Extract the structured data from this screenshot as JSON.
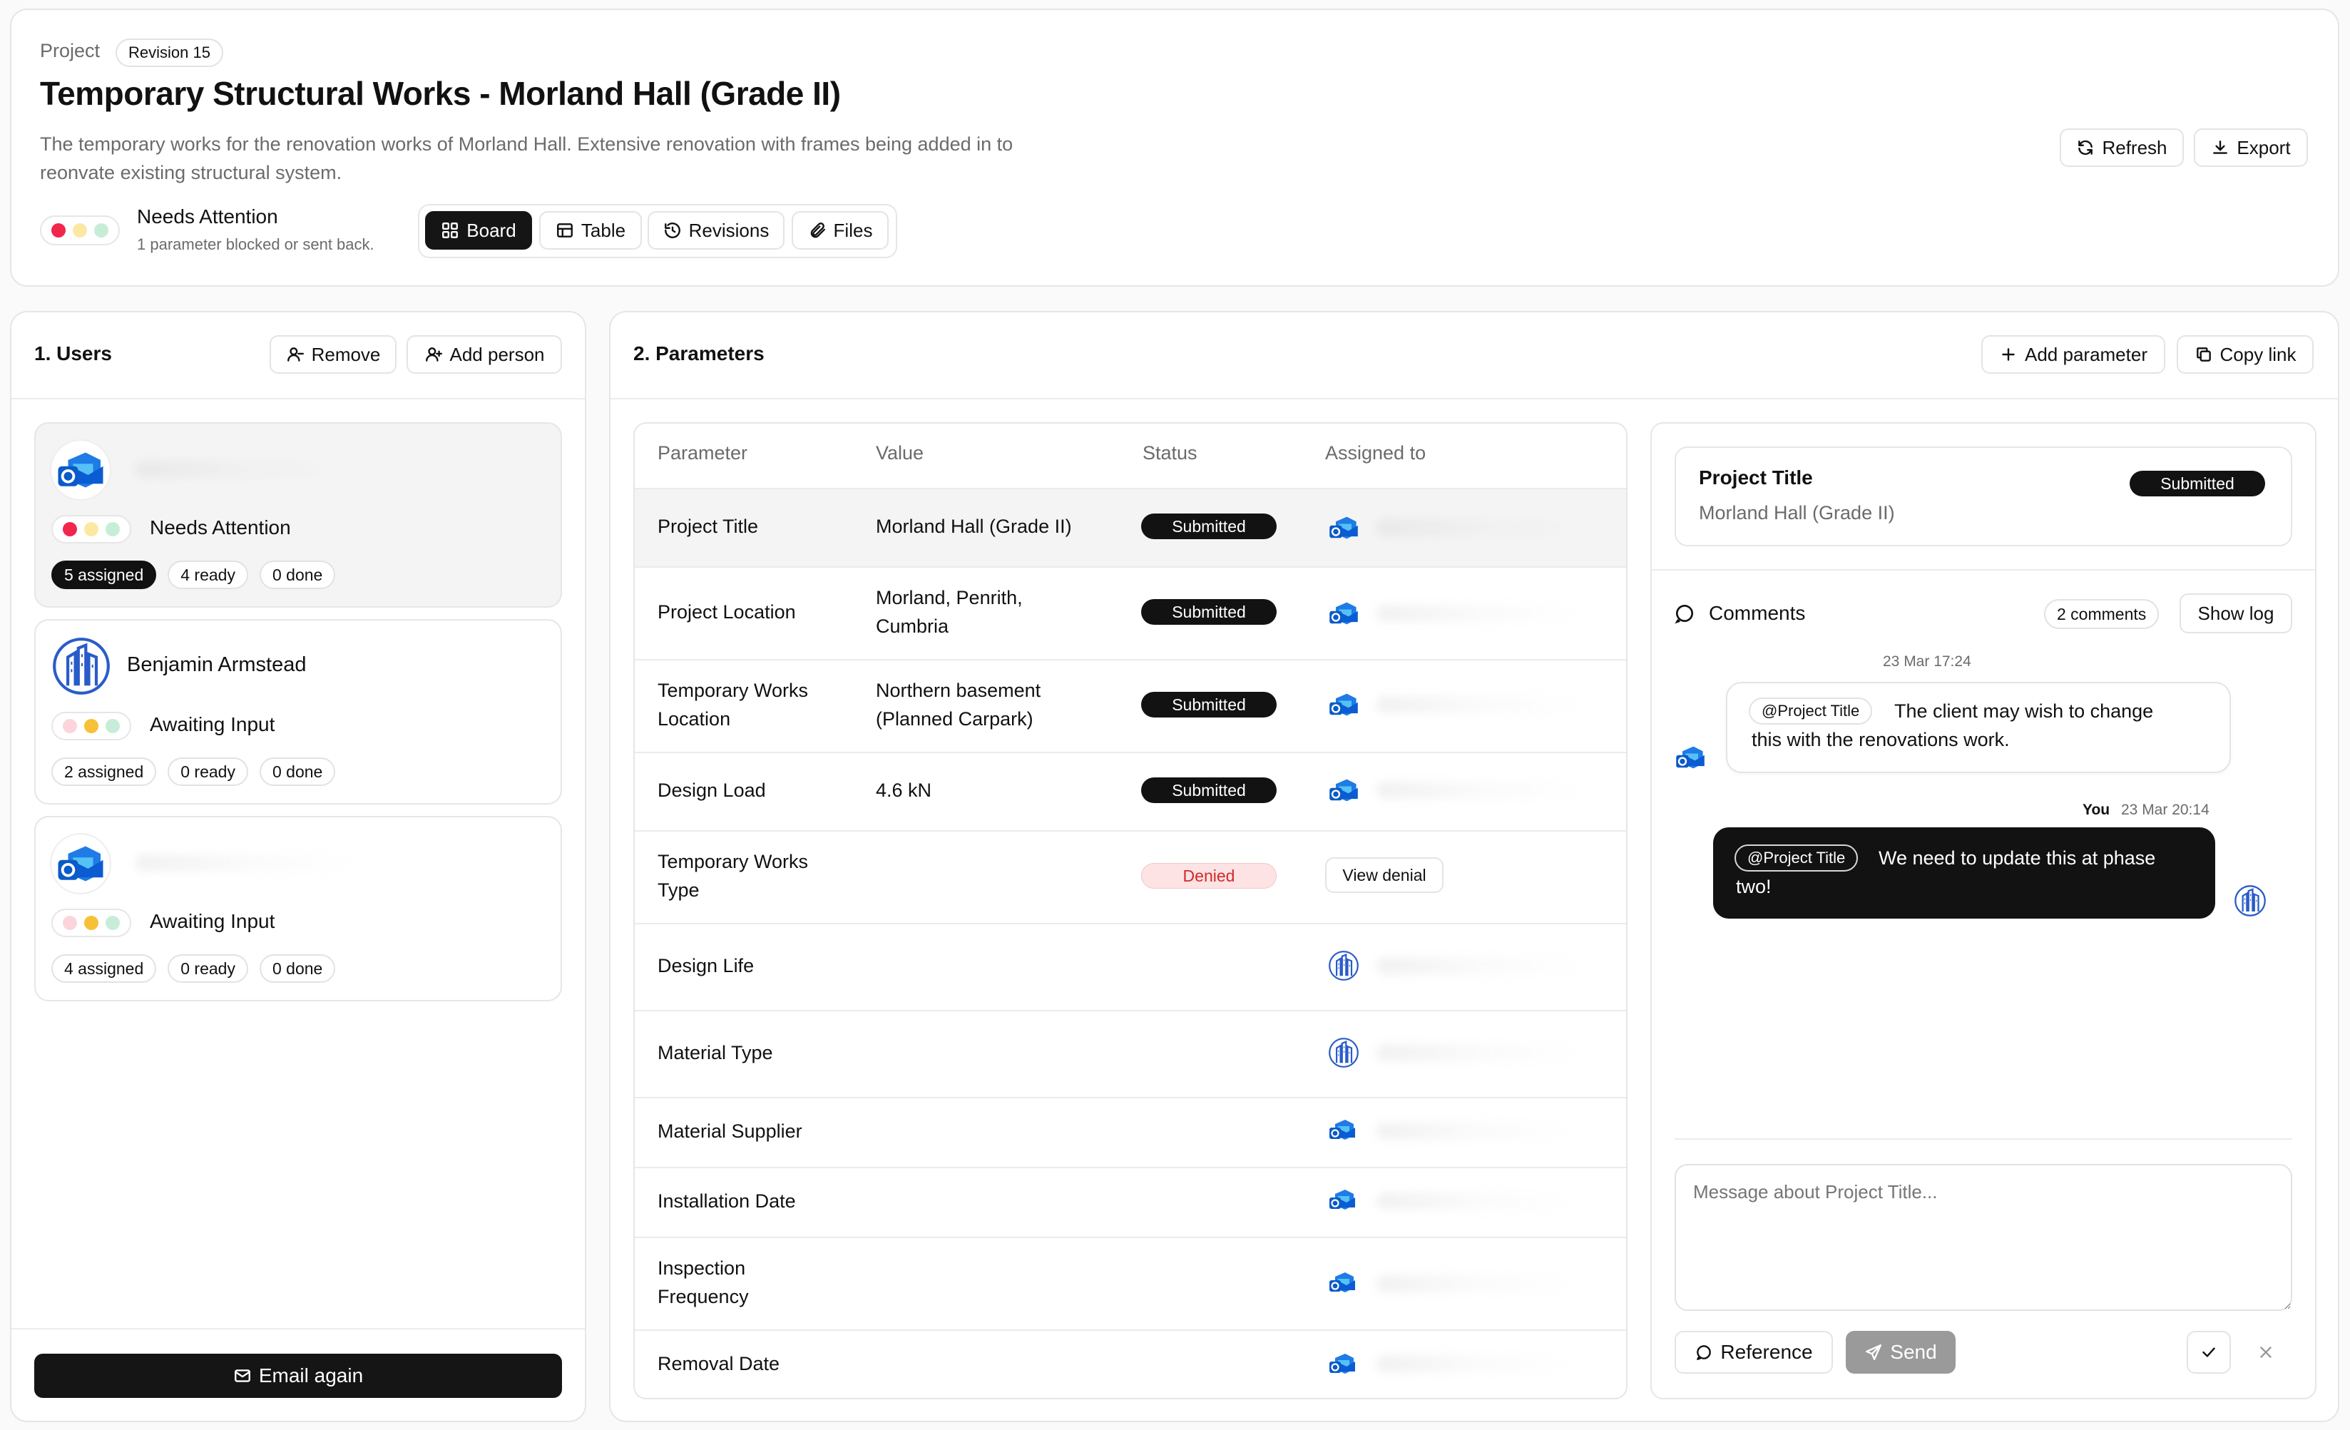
{
  "header": {
    "eyebrow": "Project",
    "revision": "Revision 15",
    "title": "Temporary Structural Works - Morland Hall (Grade II)",
    "description_line1": "The temporary works for the renovation works of Morland Hall. Extensive renovation with frames being added in to",
    "description_line2": "reonvate existing structural system.",
    "status_title": "Needs Attention",
    "status_sub": "1 parameter blocked or sent back.",
    "refresh": "Refresh",
    "export": "Export",
    "tabs": [
      "Board",
      "Table",
      "Revisions",
      "Files"
    ]
  },
  "users": {
    "title": "1. Users",
    "remove": "Remove",
    "add_person": "Add person",
    "cards": [
      {
        "name": "",
        "status": "Needs Attention",
        "assigned": "5 assigned",
        "ready": "4 ready",
        "done": "0 done"
      },
      {
        "name": "Benjamin Armstead",
        "status": "Awaiting Input",
        "assigned": "2 assigned",
        "ready": "0 ready",
        "done": "0 done"
      },
      {
        "name": "",
        "status": "Awaiting Input",
        "assigned": "4 assigned",
        "ready": "0 ready",
        "done": "0 done"
      }
    ],
    "email_again": "Email again"
  },
  "parameters": {
    "title": "2. Parameters",
    "add_parameter": "Add parameter",
    "copy_link": "Copy link",
    "columns": [
      "Parameter",
      "Value",
      "Status",
      "Assigned to"
    ],
    "rows": [
      {
        "p1": "Project Title",
        "p2": "",
        "v1": "Morland Hall (Grade II)",
        "v2": "",
        "status": "Submitted"
      },
      {
        "p1": "Project Location",
        "p2": "",
        "v1": "Morland, Penrith,",
        "v2": "Cumbria",
        "status": "Submitted"
      },
      {
        "p1": "Temporary Works",
        "p2": "Location",
        "v1": "Northern basement",
        "v2": "(Planned Carpark)",
        "status": "Submitted"
      },
      {
        "p1": "Design Load",
        "p2": "",
        "v1": "4.6 kN",
        "v2": "",
        "status": "Submitted"
      },
      {
        "p1": "Temporary Works",
        "p2": "Type",
        "v1": "",
        "v2": "",
        "status": "Denied",
        "action": "View denial"
      },
      {
        "p1": "Design Life",
        "p2": "",
        "v1": "",
        "v2": "",
        "status": ""
      },
      {
        "p1": "Material Type",
        "p2": "",
        "v1": "",
        "v2": "",
        "status": ""
      },
      {
        "p1": "Material Supplier",
        "p2": "",
        "v1": "",
        "v2": "",
        "status": ""
      },
      {
        "p1": "Installation Date",
        "p2": "",
        "v1": "",
        "v2": "",
        "status": ""
      },
      {
        "p1": "Inspection",
        "p2": "Frequency",
        "v1": "",
        "v2": "",
        "status": ""
      },
      {
        "p1": "Removal Date",
        "p2": "",
        "v1": "",
        "v2": "",
        "status": ""
      }
    ]
  },
  "detail": {
    "title": "Project Title",
    "value": "Morland Hall (Grade II)",
    "status": "Submitted",
    "comments_label": "Comments",
    "comments_count": "2 comments",
    "show_log": "Show log",
    "msg1_time": "23 Mar 17:24",
    "msg1_tag": "@Project Title",
    "msg1_text_a": "The client may wish to change",
    "msg1_text_b": "this with the renovations work.",
    "msg2_author": "You",
    "msg2_time": "23 Mar 20:14",
    "msg2_tag": "@Project Title",
    "msg2_text_a": "We need to update this at phase",
    "msg2_text_b": "two!",
    "input_placeholder": "Message about Project Title...",
    "reference": "Reference",
    "send": "Send"
  },
  "colors": {
    "red": "#f0264c",
    "yellow": "#f6c136",
    "green": "#7fd6a6",
    "dark": "#111111",
    "denied": "#d02a2a"
  }
}
